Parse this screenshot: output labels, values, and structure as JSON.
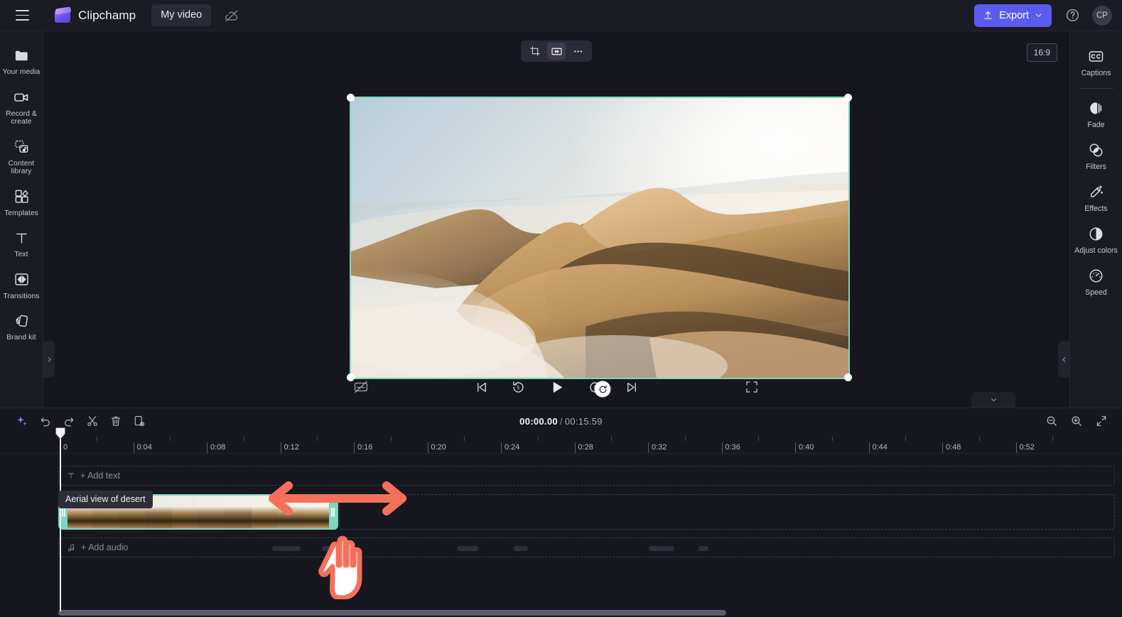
{
  "app": {
    "brand": "Clipchamp",
    "document_title": "My video",
    "cloud_status_icon": "cloud-off-icon",
    "export_label": "Export",
    "avatar_initials": "CP"
  },
  "left_rail": {
    "items": [
      {
        "label": "Your media",
        "icon": "media-folder-icon"
      },
      {
        "label": "Record & create",
        "icon": "video-camera-icon"
      },
      {
        "label": "Content library",
        "icon": "content-library-icon"
      },
      {
        "label": "Templates",
        "icon": "templates-icon"
      },
      {
        "label": "Text",
        "icon": "text-icon"
      },
      {
        "label": "Transitions",
        "icon": "transitions-icon"
      },
      {
        "label": "Brand kit",
        "icon": "brand-kit-icon"
      }
    ]
  },
  "right_rail": {
    "items": [
      {
        "label": "Captions",
        "icon": "closed-caption-icon"
      },
      {
        "label": "Fade",
        "icon": "fade-icon"
      },
      {
        "label": "Filters",
        "icon": "filters-icon"
      },
      {
        "label": "Effects",
        "icon": "effects-wand-icon"
      },
      {
        "label": "Adjust colors",
        "icon": "adjust-colors-icon"
      },
      {
        "label": "Speed",
        "icon": "speedometer-icon"
      }
    ]
  },
  "preview": {
    "aspect_ratio": "16:9",
    "float_toolbar": [
      {
        "name": "crop-button",
        "icon": "crop-icon"
      },
      {
        "name": "fit-fill-button",
        "icon": "fit-fill-icon"
      },
      {
        "name": "more-options-button",
        "icon": "ellipsis-icon"
      }
    ],
    "clip_alt": "Aerial view of desert sand dunes above clouds"
  },
  "player": {
    "mute_subtitle_icon": "subtitles-off-icon",
    "controls": [
      {
        "name": "skip-to-start-button",
        "icon": "skip-previous-icon"
      },
      {
        "name": "rewind-5-button",
        "icon": "replay-5-icon"
      },
      {
        "name": "play-button",
        "icon": "play-icon"
      },
      {
        "name": "forward-5-button",
        "icon": "forward-5-icon"
      },
      {
        "name": "skip-to-end-button",
        "icon": "skip-next-icon"
      }
    ],
    "fullscreen_icon": "fullscreen-icon",
    "rotate_icon": "rotate-icon"
  },
  "timeline": {
    "toolbar_left": [
      {
        "name": "magic-suggestion-button",
        "icon": "sparkle-icon"
      },
      {
        "name": "undo-button",
        "icon": "undo-icon"
      },
      {
        "name": "redo-button",
        "icon": "redo-icon"
      },
      {
        "name": "split-button",
        "icon": "scissors-icon"
      },
      {
        "name": "delete-button",
        "icon": "trash-icon"
      },
      {
        "name": "duplicate-button",
        "icon": "duplicate-icon"
      }
    ],
    "toolbar_right": [
      {
        "name": "zoom-out-button",
        "icon": "zoom-out-icon"
      },
      {
        "name": "zoom-in-button",
        "icon": "zoom-in-icon"
      },
      {
        "name": "fit-timeline-button",
        "icon": "fit-to-screen-icon"
      }
    ],
    "current_time": "00:00.00",
    "separator": "/",
    "total_time": "00:15.59",
    "ruler_labels": [
      "0",
      "0:04",
      "0:08",
      "0:12",
      "0:16",
      "0:20",
      "0:24",
      "0:28",
      "0:32",
      "0:36",
      "0:40",
      "0:44",
      "0:48",
      "0:52"
    ],
    "add_text_label": "+ Add text",
    "add_audio_label": "+ Add audio",
    "clip_tooltip": "Aerial view of desert"
  },
  "colors": {
    "accent": "#5b5bf0",
    "clip_selection": "#7fd6c0",
    "annotation": "#f4705a",
    "panel_bg": "#1b1b24",
    "stage_bg": "#16161e"
  }
}
